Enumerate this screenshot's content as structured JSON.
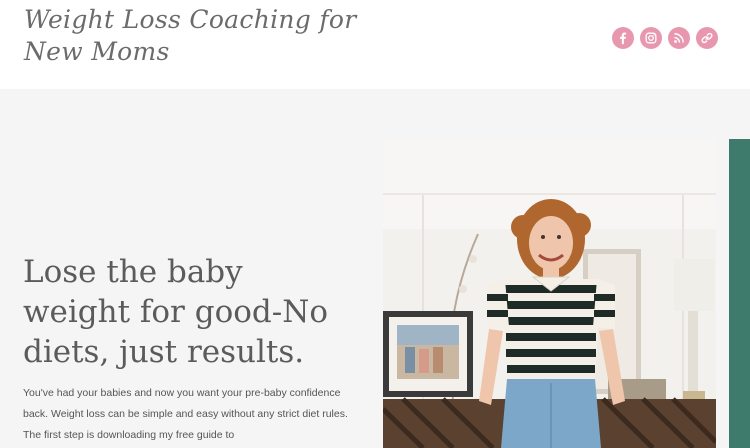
{
  "header": {
    "site_title": "Weight Loss Coaching for New Moms",
    "social": [
      {
        "name": "facebook",
        "icon": "facebook-icon"
      },
      {
        "name": "instagram",
        "icon": "instagram-icon"
      },
      {
        "name": "rss",
        "icon": "rss-icon"
      },
      {
        "name": "website",
        "icon": "link-icon"
      }
    ]
  },
  "hero": {
    "headline": "Lose the baby weight for good-No diets, just results.",
    "intro": "You've had your babies and now you want your pre-baby confidence back. Weight loss can be simple and easy without any strict diet rules. The first step is downloading my free guide to"
  },
  "colors": {
    "accent_pink": "#e898ae",
    "accent_teal": "#3e7b6c",
    "hero_background": "#f5f5f5"
  }
}
